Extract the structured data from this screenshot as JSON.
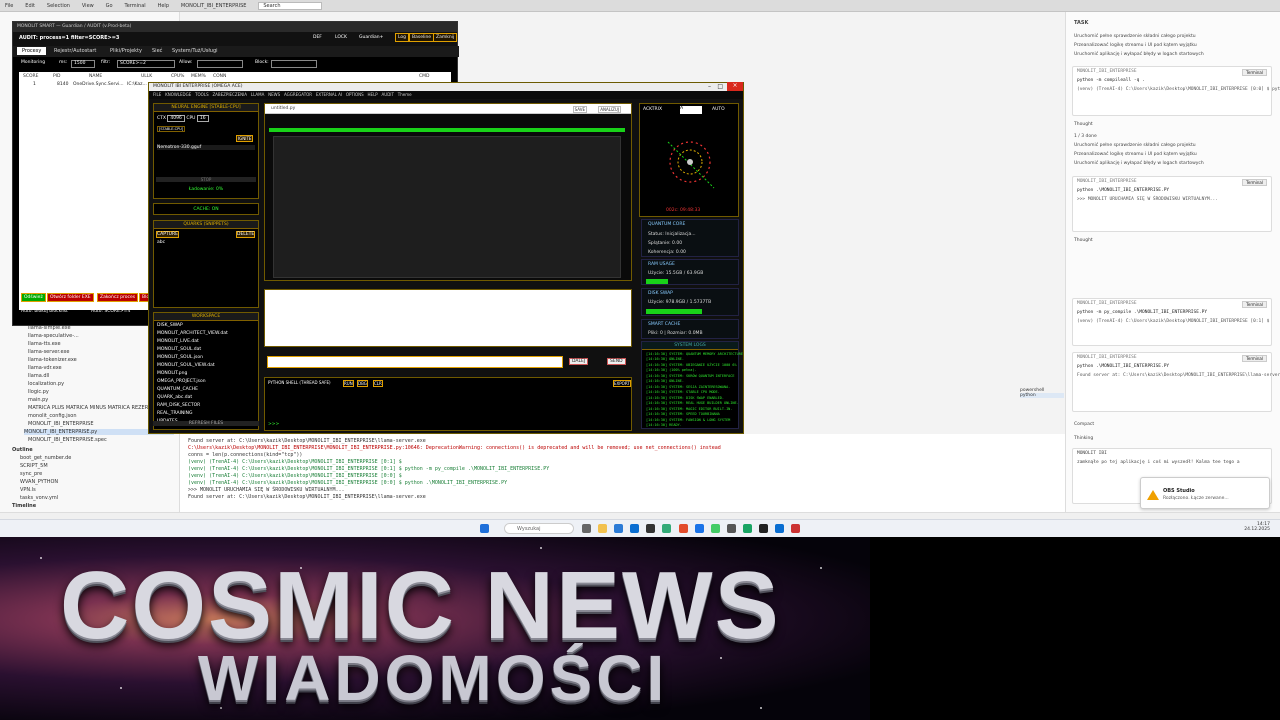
{
  "vscode": {
    "menu": [
      "File",
      "Edit",
      "Selection",
      "View",
      "Go",
      "Terminal",
      "Help"
    ],
    "active_title": "MONOLIT_IBI_ENTERPRISE",
    "search_placeholder": "Search",
    "explorer": [
      "llama-simple.exe",
      "llama-speculative-...",
      "llama-tts.exe",
      "llama-server.exe",
      "llama-tokenizer.exe",
      "llama-vdr.exe",
      "llama.dll",
      "localization.py",
      "llogic.py",
      "main.py",
      "MATRICA PLUS MATRICA MINUS MATRICA REZERV",
      "monolit_config.json",
      "MONOLIT_IBI_ENTERPRISE",
      "MONOLIT_IBI_ENTERPRISE.py",
      "MONOLIT_IBI_ENTERPRISE.spec"
    ],
    "explorer_selected": "MONOLIT_IBI_ENTERPRISE.py",
    "outline_title": "Outline",
    "outline": [
      "boot_get_number.de",
      "SCRIPT_5M",
      "sync_pre",
      "WVAN_PYTHON",
      "VPN.ls",
      "tasks_vonv.yml"
    ],
    "timeline_title": "Timeline",
    "terminal_lines": [
      "Found server at: C:\\Users\\kazik\\Desktop\\MONOLIT_IBI_ENTERPRISE\\llama-server.exe",
      "C:\\Users\\kazik\\Desktop\\MONOLIT_IBI_ENTERPRISE\\MONOLIT_IBI_ENTERPRISE.py:10646: DeprecationWarning: connections() is deprecated and will be removed; use net_connections() instead",
      "  conns = len(p.connections(kind=\"tcp\"))",
      "(venv) (TrenAI-4) C:\\Users\\kazik\\Desktop\\MONOLIT_IBI_ENTERPRISE [0:1] $",
      "(venv) (TrenAI-4) C:\\Users\\kazik\\Desktop\\MONOLIT_IBI_ENTERPRISE [0:1] $ python -m py_compile .\\MONOLIT_IBI_ENTERPRISE.PY",
      "(venv) (TrenAI-4) C:\\Users\\kazik\\Desktop\\MONOLIT_IBI_ENTERPRISE [0:0] $",
      "(venv) (TrenAI-4) C:\\Users\\kazik\\Desktop\\MONOLIT_IBI_ENTERPRISE [0:0] $ python .\\MONOLIT_IBI_ENTERPRISE.PY",
      ">>> MONOLIT URUCHAMIA SIĘ W ŚRODOWISKU WIRTUALNYM...",
      "Found server at: C:\\Users\\kazik\\Desktop\\MONOLIT_IBI_ENTERPRISE\\llama-server.exe"
    ],
    "terminal_tabs": [
      "powershell",
      "python"
    ]
  },
  "chat": {
    "title": "TASK",
    "todo": [
      "Uruchomić pełne sprawdzenie składni całego projektu",
      "Przeanalizować logikę streamu i UI pod kątem wyjątku",
      "Uruchomić aplikację i wyłapać błędy w logach startowych"
    ],
    "blocks": [
      {
        "label": "MONOLIT_IBI_ENTERPRISE",
        "badge": "Auto-Run",
        "btn": "Terminal",
        "cmd": "python -m compileall -q .",
        "out": "(venv) (TrenAI-4) C:\\Users\\kazik\\Desktop\\MONOLIT_IBI_ENTERPRISE [0:0] $ python -m compileall -q ."
      },
      {
        "label": "MONOLIT_IBI_ENTERPRISE",
        "badge": "",
        "btn": "Terminal",
        "cmd": "python .\\MONOLIT_IBI_ENTERPRISE.PY",
        "out": ">>> MONOLIT URUCHAMIA SIĘ W ŚRODOWISKU WIRTUALNYM..."
      },
      {
        "label": "MONOLIT_IBI_ENTERPRISE",
        "badge": "Auto-Run",
        "btn": "Terminal",
        "cmd": "python -m py_compile .\\MONOLIT_IBI_ENTERPRISE.PY",
        "out": "(venv) (TrenAI-4) C:\\Users\\kazik\\Desktop\\MONOLIT_IBI_ENTERPRISE [0:1] $"
      },
      {
        "label": "MONOLIT_IBI_ENTERPRISE",
        "badge": "Auto-Run",
        "btn": "Terminal",
        "cmd": "python .\\MONOLIT_IBI_ENTERPRISE.PY",
        "out": "Found server at: C:\\Users\\kazik\\Desktop\\MONOLIT_IBI_ENTERPRISE\\llama-server.exe"
      }
    ],
    "thought": "Thought",
    "progress": "1 / 3 done",
    "compact": "Compact",
    "thinking": "Thinking",
    "input_hint": "zamknąłe po tej aplikację i coś mi wyszedł! Kalma tee tego a",
    "model": "MONOLIT IBI"
  },
  "obs": {
    "title": "OBS Studio",
    "body": "Rozłączono. Łącze zerwane..."
  },
  "taskbar": {
    "search": "Wyszukaj",
    "time": "14:17",
    "date": "24.12.2025"
  },
  "win1": {
    "title": "MONOLIT SMART — Guardian / AUDIT (v.Prod-beta)",
    "header": "AUDIT: process=1 filter=SCORE>=3",
    "checks": [
      "DEF",
      "LOCK",
      "Guardian+"
    ],
    "buttons": [
      "Log",
      "Baseline",
      "Zamknij"
    ],
    "tabs": [
      "Procesy",
      "Rejestr/Autostart",
      "Pliki/Projekty",
      "Sieć",
      "System/Tuż/Usługi"
    ],
    "monitoring_label": "Monitoring",
    "ms_label": "ms:",
    "ms_value": "1500",
    "filter_label": "filtr:",
    "filter_value": "SCORE>=2",
    "allow_label": "Allow:",
    "block_label": "Block:",
    "columns": [
      "SCORE",
      "PID",
      "NAME",
      "ULLK",
      "CPU%",
      "MEM%",
      "CONN",
      "",
      "CMD"
    ],
    "row": [
      "1",
      "8140",
      "OneDrive.Sync.Servi...",
      "IC:\\Kaz..."
    ],
    "bottom_buttons": [
      "Odśwież",
      "Otwórz folder EXE",
      "Zakończ proces",
      "Blok"
    ],
    "auto_block": "Auto: blokuj blocklist",
    "auto_score": "Auto: SCORE>=4"
  },
  "win2": {
    "title": "MONOLIT IBI ENTERPRISE (OMEGA ACE)",
    "menu": [
      "FILE",
      "KNOWLEDGE",
      "TOOLS",
      "ZABEZPIECZENIA",
      "LLAMA",
      "NEWS",
      "AGGREGATOR",
      "EXTERNAL AI",
      "OPTIONS",
      "HELP",
      "AUDIT",
      "Theme"
    ],
    "neural": {
      "title": "NEURAL ENGINE [STABLE-CPU]",
      "ctx_label": "CTX",
      "ctx_value": "4096",
      "cpu_label": "CPU",
      "cpu_value": "16",
      "stable_tag": "[STABLE-CPU]",
      "ignite": "IGNITE",
      "model_file": "Nemotron-330.gguf",
      "stop": "STOP",
      "loading": "Ładowanie: 0%",
      "cache": "CACHE: ON"
    },
    "quarks": {
      "title": "QUARKS (SNIPPETS)",
      "capture": "CAPTURE",
      "delete": "DELETE",
      "item": "abc"
    },
    "workspace": {
      "title": "WORKSPACE",
      "files": [
        "DISK_SWAP",
        "MONOLIT_ARCHITECT_VIEW.dat",
        "MONOLIT_LIVE.dat",
        "MONOLIT_SOUL.dat",
        "MONOLIT_SOUL.json",
        "MONOLIT_SOUL_VIEW.dat",
        "MONOLIT.png",
        "OMEGA_PROJECT.json",
        "QUANTUM_CACHE",
        "QUARK_abc.dat",
        "RAM_DISK_SECTOR",
        "REAL_TRAINING",
        "UPDATES"
      ],
      "refresh": "REFRESH FILES"
    },
    "editor": {
      "tab": "untitled.py",
      "save": "SAVE",
      "analyze": "ANALIZUJ"
    },
    "input": {
      "send": "SEND",
      "next": "DALEJ"
    },
    "shell": {
      "title": "PYTHON SHELL (THREAD SAFE)",
      "buttons": [
        "RUN",
        "DBG",
        "CLR"
      ],
      "export": "EXPORT",
      "prompt": ">>>"
    },
    "right": {
      "acktrix": "ACKTRIX",
      "auto": "AUTO",
      "field": "A",
      "clock": "002c: 09:48:33",
      "quantum_title": "QUANTUM CORE",
      "quantum_stats": [
        "Status: Inicjalizacja...",
        "Splątanie: 0.00",
        "Koherencja: 0.00"
      ],
      "ram_title": "RAM USAGE",
      "ram_text": "Użycie: 15.5GB / 63.9GB",
      "ram_fill": 0.24,
      "disk_title": "DISK SWAP",
      "disk_text": "Użycie: 978.9GB / 1.5737TB",
      "disk_fill": 0.62,
      "cache_title": "SMART CACHE",
      "cache_text": "Pliki: 0 | Rozmiar: 0.0MB",
      "logs_title": "SYSTEM LOGS",
      "logs": [
        "[14:16:30] SYSTEM: QUANTUM MEMORY ARCHITECTURE",
        "[14:16:30] ONLINE.",
        "[14:16:30] SYSTEM: UBIEGANIE UŻYCIE 1000 6%",
        "[14:16:30] (100% pełna).",
        "[14:16:30] SYSTEM: SKRÓW QUANTUM INTERFACE",
        "[14:16:30] ONLINE.",
        "[14:16:30] SYSTEM: SESJA ZAINTERESOWANA.",
        "[14:16:30] SYSTEM: STABLE CPU MODE.",
        "[14:16:30] SYSTEM: DISK SWAP ENABLED.",
        "[14:16:30] SYSTEM: REAL HUGE BUILDER ONLINE.",
        "[14:16:30] SYSTEM: MAGIC EDITOR BUILT-IN.",
        "[14:16:30] SYSTEM: SPEED TOURBINANA",
        "[14:16:30] SYSTEM: FANSION & LONG SYSTEM",
        "[14:16:30] READY."
      ]
    }
  },
  "banner": {
    "line1": "COSMIC NEWS",
    "line2": "WIADOMOŚCI"
  }
}
